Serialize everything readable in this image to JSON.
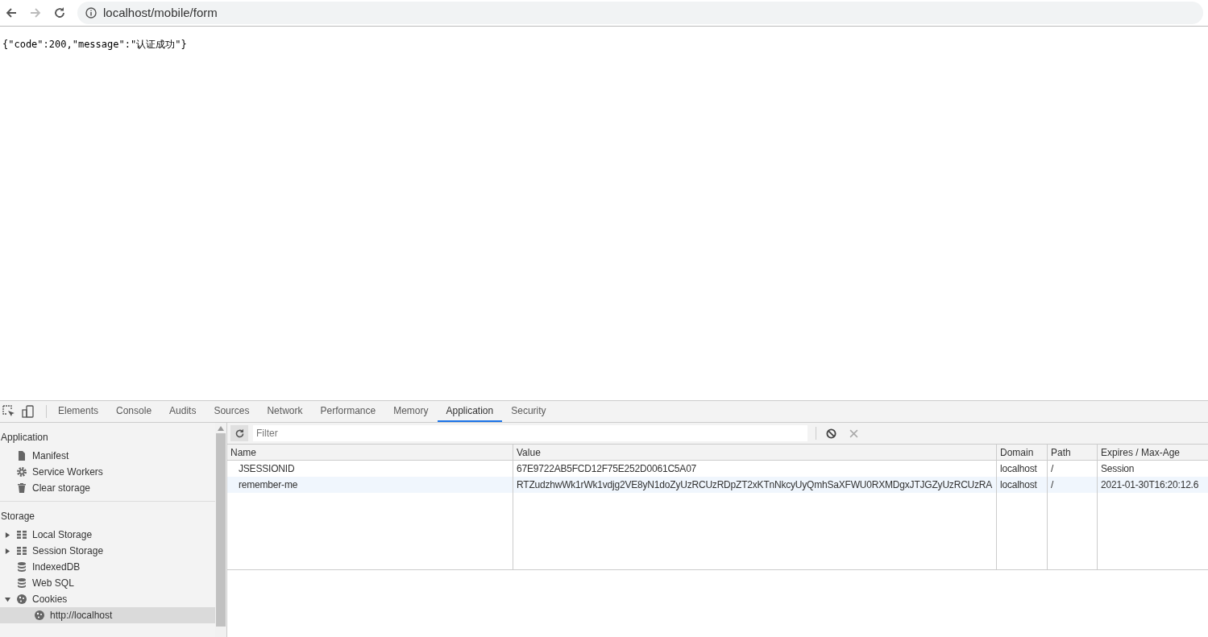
{
  "browser": {
    "url": "localhost/mobile/form"
  },
  "page": {
    "body": "{\"code\":200,\"message\":\"认证成功\"}"
  },
  "devtools": {
    "tabs": [
      {
        "label": "Elements",
        "selected": false
      },
      {
        "label": "Console",
        "selected": false
      },
      {
        "label": "Audits",
        "selected": false
      },
      {
        "label": "Sources",
        "selected": false
      },
      {
        "label": "Network",
        "selected": false
      },
      {
        "label": "Performance",
        "selected": false
      },
      {
        "label": "Memory",
        "selected": false
      },
      {
        "label": "Application",
        "selected": true
      },
      {
        "label": "Security",
        "selected": false
      }
    ],
    "sidebar": {
      "sections": [
        {
          "title": "Application",
          "items": [
            {
              "label": "Manifest",
              "kind": "file",
              "selected": false
            },
            {
              "label": "Service Workers",
              "kind": "gear",
              "selected": false
            },
            {
              "label": "Clear storage",
              "kind": "trash",
              "selected": false
            }
          ]
        },
        {
          "title": "Storage",
          "items": [
            {
              "label": "Local Storage",
              "kind": "grid",
              "expanded": false,
              "selected": false
            },
            {
              "label": "Session Storage",
              "kind": "grid",
              "expanded": false,
              "selected": false
            },
            {
              "label": "IndexedDB",
              "kind": "db",
              "selected": false
            },
            {
              "label": "Web SQL",
              "kind": "db",
              "selected": false
            },
            {
              "label": "Cookies",
              "kind": "cookie",
              "expanded": true,
              "selected": false,
              "children": [
                {
                  "label": "http://localhost",
                  "kind": "cookie",
                  "selected": true
                }
              ]
            }
          ]
        }
      ]
    },
    "filter": {
      "placeholder": "Filter"
    },
    "table": {
      "columns": [
        "Name",
        "Value",
        "Domain",
        "Path",
        "Expires / Max-Age"
      ],
      "rows": [
        {
          "cells": [
            "JSESSIONID",
            "67E9722AB5FCD12F75E252D0061C5A07",
            "localhost",
            "/",
            "Session"
          ],
          "selected": false
        },
        {
          "cells": [
            "remember-me",
            "RTZudzhwWk1rWk1vdjg2VE8yN1doZyUzRCUzRDpZT2xKTnNkcyUyQmhSaXFWU0RXMDgxJTJGZyUzRCUzRA",
            "localhost",
            "/",
            "2021-01-30T16:20:12.6"
          ],
          "selected": true
        }
      ]
    }
  }
}
